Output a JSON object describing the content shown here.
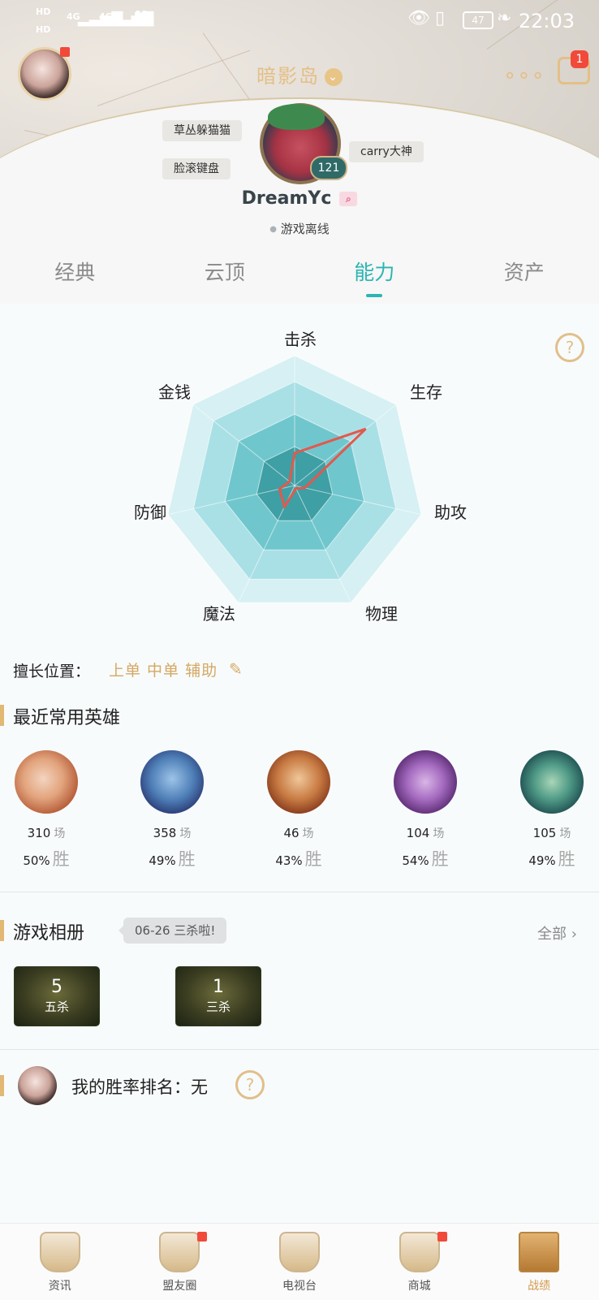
{
  "status_bar": {
    "left_indicators": [
      "HD",
      "4G",
      "4G"
    ],
    "battery": "47",
    "time": "22:03"
  },
  "header": {
    "server": "暗影岛",
    "username": "DreamYc",
    "level": "121",
    "online_status": "游戏离线",
    "tags": [
      "草丛躲猫猫",
      "脸滚键盘",
      "carry大神"
    ],
    "message_badge": "1"
  },
  "tabs": [
    {
      "label": "经典",
      "active": false
    },
    {
      "label": "云顶",
      "active": false
    },
    {
      "label": "能力",
      "active": true
    },
    {
      "label": "资产",
      "active": false
    }
  ],
  "radar": {
    "axes": [
      "击杀",
      "生存",
      "助攻",
      "物理",
      "魔法",
      "防御",
      "金钱"
    ],
    "values": [
      0.25,
      0.7,
      0.08,
      0.0,
      0.18,
      0.12,
      0.05
    ],
    "colors": {
      "ring_outer": "#d6f0f3",
      "ring_2": "#a9e0e6",
      "ring_3": "#6fc7cd",
      "ring_inner": "#3e9fa4",
      "line": "#e2594d"
    }
  },
  "position": {
    "label": "擅长位置：",
    "value": "上单 中单 辅助"
  },
  "recent_heroes": {
    "title": "最近常用英雄",
    "games_unit": "场",
    "win_unit": "胜",
    "items": [
      {
        "games": "310",
        "win": "50%"
      },
      {
        "games": "358",
        "win": "49%"
      },
      {
        "games": "46",
        "win": "43%"
      },
      {
        "games": "104",
        "win": "54%"
      },
      {
        "games": "105",
        "win": "49%"
      }
    ]
  },
  "album": {
    "title": "游戏相册",
    "bubble": "06-26 三杀啦!",
    "all_link": "全部",
    "items": [
      {
        "count": "5",
        "label": "五杀"
      },
      {
        "count": "1",
        "label": "三杀"
      }
    ]
  },
  "rank": {
    "text": "我的胜率排名：无"
  },
  "bottom_nav": [
    {
      "label": "资讯",
      "badge": false,
      "active": false
    },
    {
      "label": "盟友圈",
      "badge": true,
      "active": false
    },
    {
      "label": "电视台",
      "badge": false,
      "active": false
    },
    {
      "label": "商城",
      "badge": true,
      "active": false
    },
    {
      "label": "战绩",
      "badge": false,
      "active": true
    }
  ]
}
